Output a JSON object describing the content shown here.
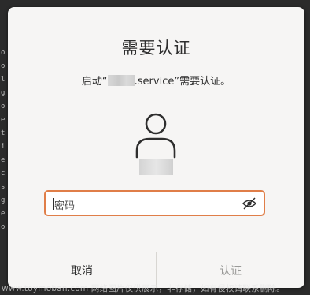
{
  "dialog": {
    "title": "需要认证",
    "message_prefix": "启动“",
    "message_suffix": ".service”需要认证。",
    "password_placeholder": "密码",
    "cancel_label": "取消",
    "confirm_label": "认证"
  },
  "background": {
    "left_edge_glyphs": [
      "o",
      "o",
      "l",
      "g",
      "o",
      "e",
      "t",
      "i",
      "e",
      "c",
      "s",
      "g",
      "e",
      "o"
    ]
  },
  "watermark": "www.toymoban.com 网络图片仅供展示，非存储，如有侵权请联系删除。",
  "colors": {
    "focus_border": "#e07e48",
    "dialog_bg": "#f6f5f4",
    "disabled_text": "#9a9a98"
  },
  "icons": {
    "avatar": "user-avatar-icon",
    "password_visibility": "eye-slash-icon"
  }
}
